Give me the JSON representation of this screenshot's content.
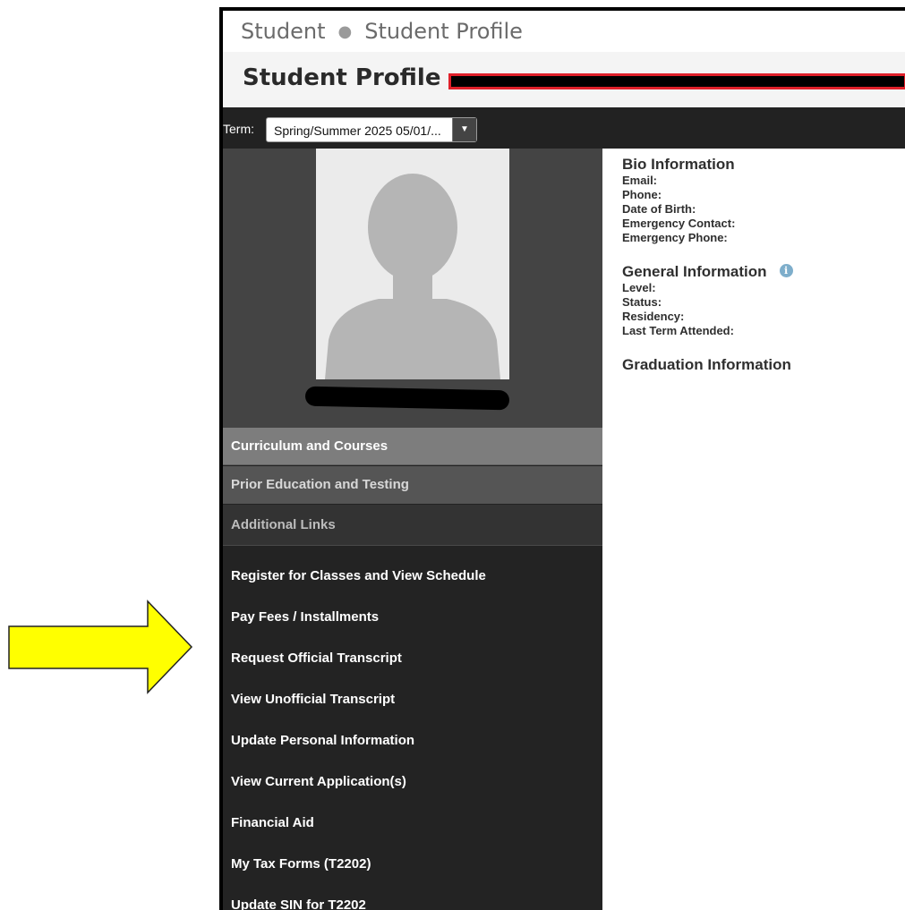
{
  "breadcrumb": {
    "root": "Student",
    "current": "Student Profile"
  },
  "page": {
    "title": "Student Profile -"
  },
  "term": {
    "label": "Term:",
    "selected": "Spring/Summer 2025 05/01/..."
  },
  "sidebar": {
    "sections": [
      "Curriculum and Courses",
      "Prior Education and Testing",
      "Additional Links"
    ],
    "links": [
      "Register for Classes and View Schedule",
      "Pay Fees / Installments",
      "Request Official Transcript",
      "View Unofficial Transcript",
      "Update Personal Information",
      "View Current Application(s)",
      "Financial Aid",
      "My Tax Forms (T2202)",
      "Update SIN for T2202"
    ]
  },
  "bio": {
    "title": "Bio Information",
    "fields": [
      "Email:",
      "Phone:",
      "Date of Birth:",
      "Emergency Contact:",
      "Emergency Phone:"
    ]
  },
  "general": {
    "title": "General Information",
    "fields": [
      "Level:",
      "Status:",
      "Residency:",
      "Last Term Attended:"
    ]
  },
  "graduation": {
    "title": "Graduation Information"
  },
  "colors": {
    "arrow_fill": "#ffff00",
    "redaction_border": "#e0202a"
  }
}
